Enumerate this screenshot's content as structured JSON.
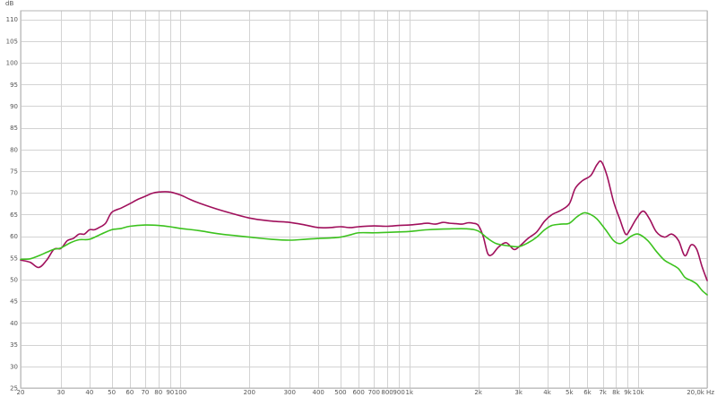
{
  "chart_data": {
    "type": "line",
    "title": "",
    "ylabel": "dB",
    "xlabel": "",
    "x_scale": "log",
    "xlim": [
      20,
      20000
    ],
    "ylim": [
      25,
      112
    ],
    "grid": true,
    "y_ticks": [
      {
        "value": 25,
        "label": "25"
      },
      {
        "value": 30,
        "label": "30"
      },
      {
        "value": 35,
        "label": "35"
      },
      {
        "value": 40,
        "label": "40"
      },
      {
        "value": 45,
        "label": "45"
      },
      {
        "value": 50,
        "label": "50"
      },
      {
        "value": 55,
        "label": "55"
      },
      {
        "value": 60,
        "label": "60"
      },
      {
        "value": 65,
        "label": "65"
      },
      {
        "value": 70,
        "label": "70"
      },
      {
        "value": 75,
        "label": "75"
      },
      {
        "value": 80,
        "label": "80"
      },
      {
        "value": 85,
        "label": "85"
      },
      {
        "value": 90,
        "label": "90"
      },
      {
        "value": 95,
        "label": "95"
      },
      {
        "value": 100,
        "label": "100"
      },
      {
        "value": 105,
        "label": "105"
      },
      {
        "value": 110,
        "label": "110"
      }
    ],
    "x_ticks": [
      {
        "value": 20,
        "label": "20"
      },
      {
        "value": 30,
        "label": "30"
      },
      {
        "value": 40,
        "label": "40"
      },
      {
        "value": 50,
        "label": "50"
      },
      {
        "value": 60,
        "label": "60"
      },
      {
        "value": 70,
        "label": "70"
      },
      {
        "value": 80,
        "label": "80"
      },
      {
        "value": 90,
        "label": "90"
      },
      {
        "value": 100,
        "label": "100"
      },
      {
        "value": 200,
        "label": "200"
      },
      {
        "value": 300,
        "label": "300"
      },
      {
        "value": 400,
        "label": "400"
      },
      {
        "value": 500,
        "label": "500"
      },
      {
        "value": 600,
        "label": "600"
      },
      {
        "value": 700,
        "label": "700"
      },
      {
        "value": 800,
        "label": "800"
      },
      {
        "value": 900,
        "label": "900"
      },
      {
        "value": 1000,
        "label": "1k"
      },
      {
        "value": 2000,
        "label": "2k"
      },
      {
        "value": 3000,
        "label": "3k"
      },
      {
        "value": 4000,
        "label": "4k"
      },
      {
        "value": 5000,
        "label": "5k"
      },
      {
        "value": 6000,
        "label": "6k"
      },
      {
        "value": 7000,
        "label": "7k"
      },
      {
        "value": 8000,
        "label": "8k"
      },
      {
        "value": 9000,
        "label": "9k"
      },
      {
        "value": 10000,
        "label": "10k"
      },
      {
        "value": 20000,
        "label": "20,0k Hz"
      }
    ],
    "series": [
      {
        "color": "#a0105c",
        "points": [
          [
            20,
            54.5
          ],
          [
            22,
            54.0
          ],
          [
            24,
            52.8
          ],
          [
            26,
            54.5
          ],
          [
            28,
            57.0
          ],
          [
            30,
            57.2
          ],
          [
            32,
            59.0
          ],
          [
            34,
            59.5
          ],
          [
            36,
            60.5
          ],
          [
            38,
            60.5
          ],
          [
            40,
            61.5
          ],
          [
            42,
            61.5
          ],
          [
            44,
            62.0
          ],
          [
            47,
            63.0
          ],
          [
            50,
            65.5
          ],
          [
            55,
            66.5
          ],
          [
            60,
            67.5
          ],
          [
            65,
            68.5
          ],
          [
            70,
            69.2
          ],
          [
            75,
            69.9
          ],
          [
            80,
            70.2
          ],
          [
            90,
            70.2
          ],
          [
            100,
            69.5
          ],
          [
            110,
            68.5
          ],
          [
            120,
            67.7
          ],
          [
            150,
            66.0
          ],
          [
            200,
            64.2
          ],
          [
            250,
            63.5
          ],
          [
            300,
            63.2
          ],
          [
            350,
            62.6
          ],
          [
            400,
            62.0
          ],
          [
            450,
            62.0
          ],
          [
            500,
            62.2
          ],
          [
            550,
            62.0
          ],
          [
            600,
            62.2
          ],
          [
            700,
            62.4
          ],
          [
            800,
            62.3
          ],
          [
            900,
            62.5
          ],
          [
            1000,
            62.6
          ],
          [
            1100,
            62.8
          ],
          [
            1200,
            63.0
          ],
          [
            1300,
            62.8
          ],
          [
            1400,
            63.2
          ],
          [
            1500,
            63.0
          ],
          [
            1600,
            62.9
          ],
          [
            1700,
            62.8
          ],
          [
            1800,
            63.1
          ],
          [
            1900,
            63.0
          ],
          [
            2000,
            62.5
          ],
          [
            2100,
            60.0
          ],
          [
            2200,
            56.0
          ],
          [
            2300,
            55.8
          ],
          [
            2450,
            57.5
          ],
          [
            2650,
            58.5
          ],
          [
            2850,
            57.0
          ],
          [
            3000,
            57.5
          ],
          [
            3300,
            59.5
          ],
          [
            3600,
            61.0
          ],
          [
            3900,
            63.5
          ],
          [
            4200,
            65.0
          ],
          [
            4600,
            66.0
          ],
          [
            5000,
            67.5
          ],
          [
            5300,
            71.0
          ],
          [
            5700,
            72.8
          ],
          [
            6200,
            74.0
          ],
          [
            6600,
            76.5
          ],
          [
            6900,
            77.2
          ],
          [
            7300,
            74.0
          ],
          [
            7800,
            68.0
          ],
          [
            8300,
            64.0
          ],
          [
            8800,
            60.5
          ],
          [
            9200,
            61.5
          ],
          [
            9800,
            64.0
          ],
          [
            10500,
            65.8
          ],
          [
            11200,
            64.0
          ],
          [
            12000,
            61.0
          ],
          [
            13000,
            59.8
          ],
          [
            14000,
            60.5
          ],
          [
            15000,
            59.0
          ],
          [
            16000,
            55.5
          ],
          [
            17000,
            58.0
          ],
          [
            18000,
            57.0
          ],
          [
            19000,
            53.0
          ],
          [
            20000,
            49.8
          ]
        ]
      },
      {
        "color": "#3cc21e",
        "points": [
          [
            20,
            54.7
          ],
          [
            22,
            54.8
          ],
          [
            24,
            55.5
          ],
          [
            26,
            56.3
          ],
          [
            28,
            57.0
          ],
          [
            30,
            57.3
          ],
          [
            33,
            58.5
          ],
          [
            36,
            59.2
          ],
          [
            40,
            59.3
          ],
          [
            45,
            60.5
          ],
          [
            50,
            61.5
          ],
          [
            55,
            61.8
          ],
          [
            60,
            62.3
          ],
          [
            70,
            62.6
          ],
          [
            80,
            62.5
          ],
          [
            90,
            62.2
          ],
          [
            100,
            61.8
          ],
          [
            120,
            61.3
          ],
          [
            150,
            60.5
          ],
          [
            200,
            59.8
          ],
          [
            250,
            59.3
          ],
          [
            300,
            59.1
          ],
          [
            350,
            59.3
          ],
          [
            400,
            59.5
          ],
          [
            450,
            59.6
          ],
          [
            500,
            59.8
          ],
          [
            550,
            60.3
          ],
          [
            600,
            60.8
          ],
          [
            700,
            60.8
          ],
          [
            800,
            60.9
          ],
          [
            900,
            61.0
          ],
          [
            1000,
            61.1
          ],
          [
            1200,
            61.5
          ],
          [
            1500,
            61.7
          ],
          [
            1800,
            61.7
          ],
          [
            2000,
            61.2
          ],
          [
            2200,
            59.5
          ],
          [
            2400,
            58.3
          ],
          [
            2700,
            57.8
          ],
          [
            3000,
            57.6
          ],
          [
            3300,
            58.5
          ],
          [
            3600,
            59.8
          ],
          [
            3900,
            61.5
          ],
          [
            4200,
            62.5
          ],
          [
            4600,
            62.8
          ],
          [
            5000,
            63.0
          ],
          [
            5400,
            64.5
          ],
          [
            5800,
            65.4
          ],
          [
            6200,
            65.0
          ],
          [
            6600,
            64.0
          ],
          [
            7200,
            61.5
          ],
          [
            7800,
            59.0
          ],
          [
            8300,
            58.3
          ],
          [
            8800,
            59.0
          ],
          [
            9300,
            60.0
          ],
          [
            10000,
            60.5
          ],
          [
            11000,
            59.0
          ],
          [
            12000,
            56.5
          ],
          [
            13000,
            54.5
          ],
          [
            14000,
            53.5
          ],
          [
            15000,
            52.5
          ],
          [
            16000,
            50.5
          ],
          [
            17000,
            49.8
          ],
          [
            18000,
            49.0
          ],
          [
            19000,
            47.5
          ],
          [
            20000,
            46.5
          ]
        ]
      }
    ]
  }
}
